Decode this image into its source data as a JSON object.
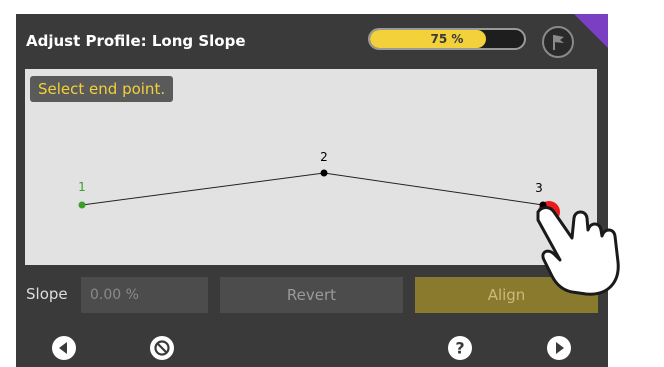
{
  "header": {
    "title": "Adjust Profile: Long Slope",
    "progress_text": "75 %",
    "progress_value": 0.75
  },
  "canvas": {
    "hint": "Select end point.",
    "points": [
      {
        "label": "1",
        "color": "#3aa02a"
      },
      {
        "label": "2",
        "color": "#000000"
      },
      {
        "label": "3",
        "color": "#000000"
      }
    ],
    "selected_color": "#ee1a1a"
  },
  "controls": {
    "slope_label": "Slope",
    "slope_placeholder": "0.00 %",
    "revert_label": "Revert",
    "align_label": "Align"
  },
  "nav": {
    "icons": [
      "back-icon",
      "cancel-icon",
      "help-icon",
      "next-icon"
    ]
  },
  "colors": {
    "accent_yellow": "#f2d13a",
    "align_button": "#8a7a2e",
    "corner_badge": "#7b3fc4"
  }
}
